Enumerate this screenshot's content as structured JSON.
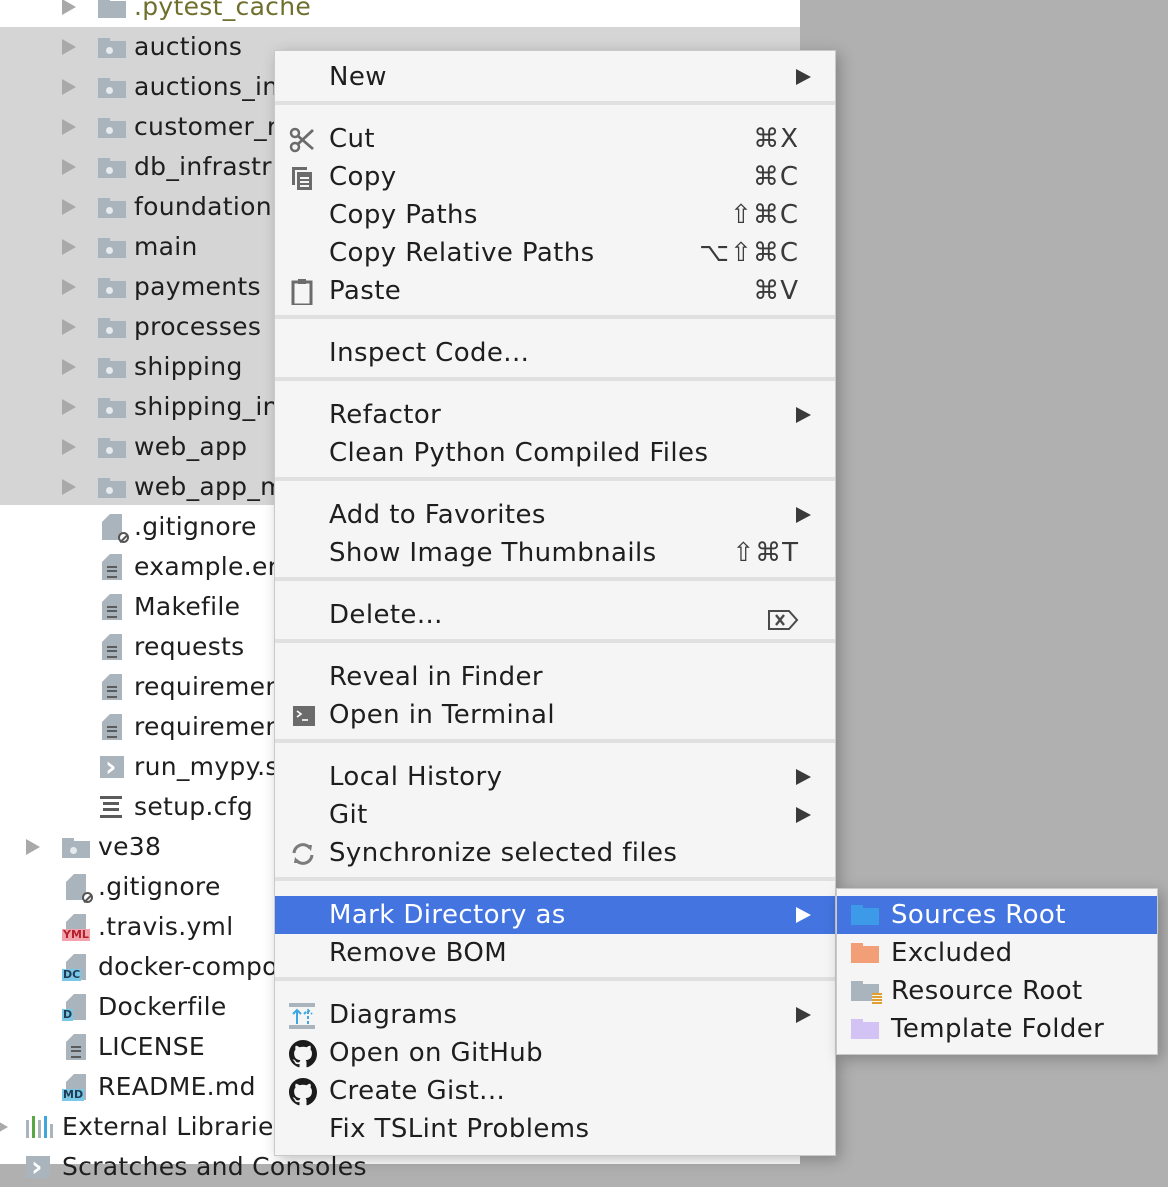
{
  "tree": {
    "items": [
      {
        "label": ".pytest_cache",
        "type": "folder",
        "expandable": true,
        "indent": 1,
        "style": "olive"
      },
      {
        "label": "auctions",
        "type": "folder",
        "expandable": true,
        "indent": 1,
        "selected": true
      },
      {
        "label": "auctions_in",
        "type": "folder",
        "expandable": true,
        "indent": 1,
        "selected": true
      },
      {
        "label": "customer_r",
        "type": "folder",
        "expandable": true,
        "indent": 1,
        "selected": true
      },
      {
        "label": "db_infrastr",
        "type": "folder",
        "expandable": true,
        "indent": 1,
        "selected": true
      },
      {
        "label": "foundation",
        "type": "folder",
        "expandable": true,
        "indent": 1,
        "selected": true
      },
      {
        "label": "main",
        "type": "folder",
        "expandable": true,
        "indent": 1,
        "selected": true
      },
      {
        "label": "payments",
        "type": "folder",
        "expandable": true,
        "indent": 1,
        "selected": true
      },
      {
        "label": "processes",
        "type": "folder",
        "expandable": true,
        "indent": 1,
        "selected": true
      },
      {
        "label": "shipping",
        "type": "folder",
        "expandable": true,
        "indent": 1,
        "selected": true
      },
      {
        "label": "shipping_in",
        "type": "folder",
        "expandable": true,
        "indent": 1,
        "selected": true
      },
      {
        "label": "web_app",
        "type": "folder",
        "expandable": true,
        "indent": 1,
        "selected": true
      },
      {
        "label": "web_app_m",
        "type": "folder",
        "expandable": true,
        "indent": 1,
        "selected": true
      },
      {
        "label": ".gitignore",
        "type": "file-ignore",
        "indent": 1
      },
      {
        "label": "example.en",
        "type": "file-text",
        "indent": 1
      },
      {
        "label": "Makefile",
        "type": "file-text",
        "indent": 1
      },
      {
        "label": "requests",
        "type": "file-text",
        "indent": 1
      },
      {
        "label": "requiremen",
        "type": "file-text",
        "indent": 1
      },
      {
        "label": "requiremen",
        "type": "file-text",
        "indent": 1
      },
      {
        "label": "run_mypy.s",
        "type": "file-script",
        "indent": 1
      },
      {
        "label": "setup.cfg",
        "type": "file-config",
        "indent": 1
      },
      {
        "label": "ve38",
        "type": "folder",
        "expandable": true,
        "indent": 0
      },
      {
        "label": ".gitignore",
        "type": "file-ignore",
        "indent": 0
      },
      {
        "label": ".travis.yml",
        "type": "file-badge",
        "badge": "YML",
        "badge_style": "yml",
        "indent": 0
      },
      {
        "label": "docker-compo",
        "type": "file-badge",
        "badge": "DC",
        "badge_style": "blue",
        "indent": 0
      },
      {
        "label": "Dockerfile",
        "type": "file-badge",
        "badge": "D",
        "badge_style": "blue",
        "indent": 0
      },
      {
        "label": "LICENSE",
        "type": "file-text",
        "indent": 0
      },
      {
        "label": "README.md",
        "type": "file-badge",
        "badge": "MD",
        "badge_style": "blue",
        "indent": 0
      },
      {
        "label": "External Libraries",
        "type": "external-libraries",
        "expandable": true,
        "indent": -1
      },
      {
        "label": "Scratches and Consoles",
        "type": "scratches",
        "indent": -1
      }
    ]
  },
  "context_menu": {
    "groups": [
      [
        {
          "label": "New",
          "submenu": true
        }
      ],
      [
        {
          "label": "Cut",
          "icon": "scissors-icon",
          "shortcut": "⌘X"
        },
        {
          "label": "Copy",
          "icon": "copy-icon",
          "shortcut": "⌘C"
        },
        {
          "label": "Copy Paths",
          "shortcut": "⇧⌘C"
        },
        {
          "label": "Copy Relative Paths",
          "shortcut": "⌥⇧⌘C"
        },
        {
          "label": "Paste",
          "icon": "clipboard-icon",
          "shortcut": "⌘V"
        }
      ],
      [
        {
          "label": "Inspect Code..."
        }
      ],
      [
        {
          "label": "Refactor",
          "submenu": true
        },
        {
          "label": "Clean Python Compiled Files"
        }
      ],
      [
        {
          "label": "Add to Favorites",
          "submenu": true
        },
        {
          "label": "Show Image Thumbnails",
          "shortcut": "⇧⌘T"
        }
      ],
      [
        {
          "label": "Delete...",
          "shortcut_icon": "delete-key-icon"
        }
      ],
      [
        {
          "label": "Reveal in Finder"
        },
        {
          "label": "Open in Terminal",
          "icon": "terminal-icon"
        }
      ],
      [
        {
          "label": "Local History",
          "submenu": true
        },
        {
          "label": "Git",
          "submenu": true
        },
        {
          "label": "Synchronize selected files",
          "icon": "sync-icon"
        }
      ],
      [
        {
          "label": "Mark Directory as",
          "submenu": true,
          "active": true
        },
        {
          "label": "Remove BOM"
        }
      ],
      [
        {
          "label": "Diagrams",
          "icon": "diagrams-icon",
          "submenu": true
        },
        {
          "label": "Open on GitHub",
          "icon": "github-icon"
        },
        {
          "label": "Create Gist...",
          "icon": "github-icon"
        },
        {
          "label": "Fix TSLint Problems"
        }
      ]
    ]
  },
  "mark_directory_submenu": {
    "items": [
      {
        "label": "Sources Root",
        "icon": "sources-root-folder-icon",
        "color": "#3d9ae8",
        "active": true
      },
      {
        "label": "Excluded",
        "icon": "excluded-folder-icon",
        "color": "#f29f77"
      },
      {
        "label": "Resource Root",
        "icon": "resource-root-folder-icon",
        "color": "#a9b4bc",
        "accent": "#e0a030"
      },
      {
        "label": "Template Folder",
        "icon": "template-folder-icon",
        "color": "#d3c3f4"
      }
    ]
  },
  "colors": {
    "selection": "#4474e0",
    "tree_selected_bg": "#d5d5d5",
    "menu_bg": "#f5f5f5"
  }
}
